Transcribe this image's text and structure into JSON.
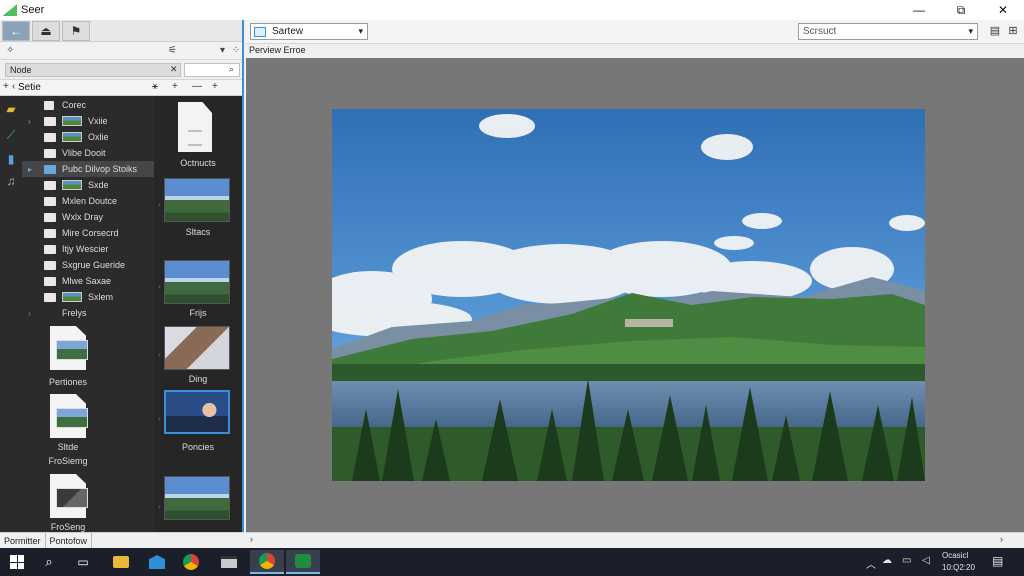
{
  "app": {
    "title": "Seer"
  },
  "window_controls": {
    "minimize": "—",
    "restore": "⧉",
    "close": "✕"
  },
  "left_toolbar": {
    "back": "←",
    "up": "⏏",
    "bookmark": "⚑"
  },
  "left_sub": {
    "left_icon": "✧",
    "right_icon": "⚟",
    "menu_icon": "▾",
    "extra": "⁘"
  },
  "path_bar": {
    "value": "Node",
    "clear": "✕",
    "search_icon": "⌕"
  },
  "tree_header": {
    "label": "Setie",
    "expand": "+",
    "collapse": "‹",
    "icon_a": "⚹",
    "icon_b": "+",
    "icon_c": "—",
    "icon_d": "+"
  },
  "tree": {
    "items": [
      {
        "label": "Corec"
      },
      {
        "label": "Vxiie"
      },
      {
        "label": "Oxlie"
      },
      {
        "label": "Vlibe Dooit"
      },
      {
        "label": "Pubc Dilvop Stoiks"
      },
      {
        "label": "Sxde"
      },
      {
        "label": "Mxlen Doutce"
      },
      {
        "label": "Wxlx Dray"
      },
      {
        "label": "Mire Corsecrd"
      },
      {
        "label": "Itjy Wescier"
      },
      {
        "label": "Sxgrue Gueride"
      },
      {
        "label": "Mlwe Saxae"
      },
      {
        "label": "Sxlem"
      },
      {
        "label": "Frelys"
      }
    ],
    "files": [
      {
        "label": "Pertiones"
      },
      {
        "label": "Sltde"
      },
      {
        "label": "FroSiemg"
      },
      {
        "label": "FroSeng"
      }
    ]
  },
  "thumbs": {
    "items": [
      {
        "label": "Octnucts"
      },
      {
        "label": "Sltacs"
      },
      {
        "label": "Frijs"
      },
      {
        "label": "Ding"
      },
      {
        "label": "Poncies"
      },
      {
        "label": ""
      }
    ]
  },
  "left_tabs": {
    "tab1": "Pormitter",
    "tab2": "Pontofow"
  },
  "right_toolbar": {
    "view_value": "Sartew",
    "search_placeholder": "Scrsuct",
    "dropdown_arrow": "▾",
    "icon_view1": "▤",
    "icon_view2": "⊞"
  },
  "preview": {
    "label": "Perview Erroe"
  },
  "bottom_bar": {
    "left": "›",
    "right": "›"
  },
  "taskbar": {
    "search": "⌕",
    "task_view": "▭",
    "tray_up": "︿",
    "clock_time": "Ocasicl",
    "clock_date": "10:Q2:20"
  }
}
